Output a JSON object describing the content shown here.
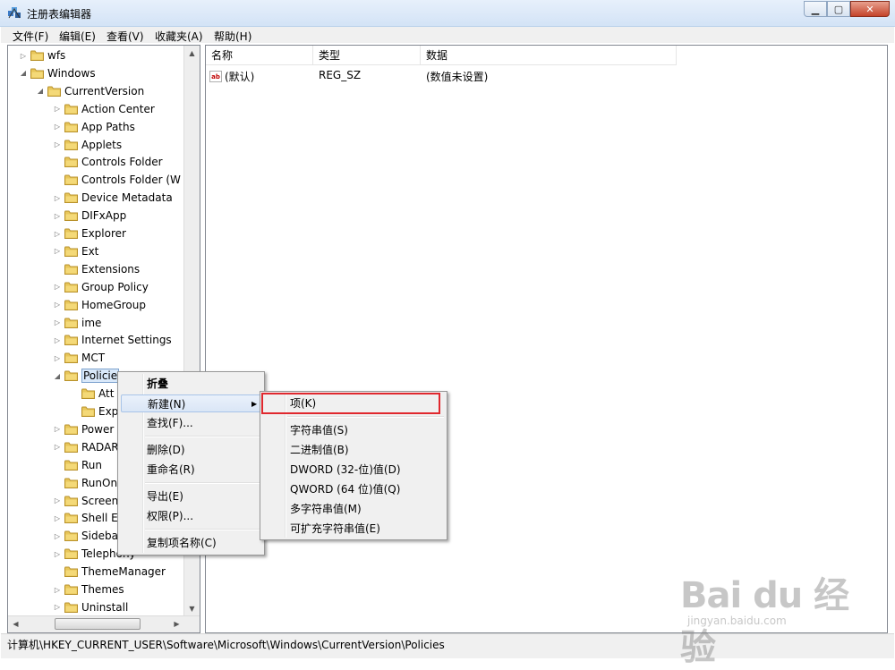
{
  "window": {
    "title": "注册表编辑器",
    "controls": {
      "minimize": "▁",
      "maximize": "▢",
      "close": "✕"
    }
  },
  "menubar": [
    "文件(F)",
    "编辑(E)",
    "查看(V)",
    "收藏夹(A)",
    "帮助(H)"
  ],
  "tree": {
    "nodes": [
      {
        "label": "wfs",
        "expander": "collapsed"
      },
      {
        "label": "Windows",
        "expander": "expanded"
      },
      {
        "label": "CurrentVersion",
        "expander": "expanded"
      },
      {
        "label": "Action Center",
        "expander": "collapsed"
      },
      {
        "label": "App Paths",
        "expander": "collapsed"
      },
      {
        "label": "Applets",
        "expander": "collapsed"
      },
      {
        "label": "Controls Folder",
        "expander": "none"
      },
      {
        "label": "Controls Folder (W",
        "expander": "none"
      },
      {
        "label": "Device Metadata",
        "expander": "collapsed"
      },
      {
        "label": "DIFxApp",
        "expander": "collapsed"
      },
      {
        "label": "Explorer",
        "expander": "collapsed"
      },
      {
        "label": "Ext",
        "expander": "collapsed"
      },
      {
        "label": "Extensions",
        "expander": "none"
      },
      {
        "label": "Group Policy",
        "expander": "collapsed"
      },
      {
        "label": "HomeGroup",
        "expander": "collapsed"
      },
      {
        "label": "ime",
        "expander": "collapsed"
      },
      {
        "label": "Internet Settings",
        "expander": "collapsed"
      },
      {
        "label": "MCT",
        "expander": "collapsed"
      },
      {
        "label": "Policie",
        "expander": "expanded",
        "selected": true
      },
      {
        "label": "Att",
        "expander": "none"
      },
      {
        "label": "Exp",
        "expander": "none"
      },
      {
        "label": "Power",
        "expander": "collapsed"
      },
      {
        "label": "RADAR",
        "expander": "collapsed"
      },
      {
        "label": "Run",
        "expander": "none"
      },
      {
        "label": "RunOn",
        "expander": "none"
      },
      {
        "label": "Screen",
        "expander": "collapsed"
      },
      {
        "label": "Shell E",
        "expander": "collapsed"
      },
      {
        "label": "Sideba",
        "expander": "collapsed"
      },
      {
        "label": "Telephony",
        "expander": "collapsed"
      },
      {
        "label": "ThemeManager",
        "expander": "none"
      },
      {
        "label": "Themes",
        "expander": "collapsed"
      },
      {
        "label": "Uninstall",
        "expander": "collapsed"
      }
    ]
  },
  "values_pane": {
    "columns": [
      "名称",
      "类型",
      "数据"
    ],
    "rows": [
      {
        "name": "(默认)",
        "type": "REG_SZ",
        "data": "(数值未设置)",
        "icon": "ab"
      }
    ]
  },
  "context_menu": {
    "items": [
      {
        "label": "折叠",
        "bold": true
      },
      {
        "label": "新建(N)",
        "has_submenu": true,
        "highlighted": true
      },
      {
        "label": "查找(F)..."
      },
      {
        "label": "删除(D)"
      },
      {
        "label": "重命名(R)"
      },
      {
        "label": "导出(E)"
      },
      {
        "label": "权限(P)..."
      },
      {
        "label": "复制项名称(C)"
      }
    ]
  },
  "submenu": {
    "items": [
      {
        "label": "项(K)",
        "annotated": true
      },
      {
        "label": "字符串值(S)"
      },
      {
        "label": "二进制值(B)"
      },
      {
        "label": "DWORD (32-位)值(D)"
      },
      {
        "label": "QWORD (64 位)值(Q)"
      },
      {
        "label": "多字符串值(M)"
      },
      {
        "label": "可扩充字符串值(E)"
      }
    ]
  },
  "statusbar": {
    "path": "计算机\\HKEY_CURRENT_USER\\Software\\Microsoft\\Windows\\CurrentVersion\\Policies"
  },
  "watermark": {
    "logo": "Bai du 经验",
    "url": "jingyan.baidu.com"
  },
  "colors": {
    "annotation_red": "#e0282e",
    "folder_yellow": "#e8c65a"
  }
}
